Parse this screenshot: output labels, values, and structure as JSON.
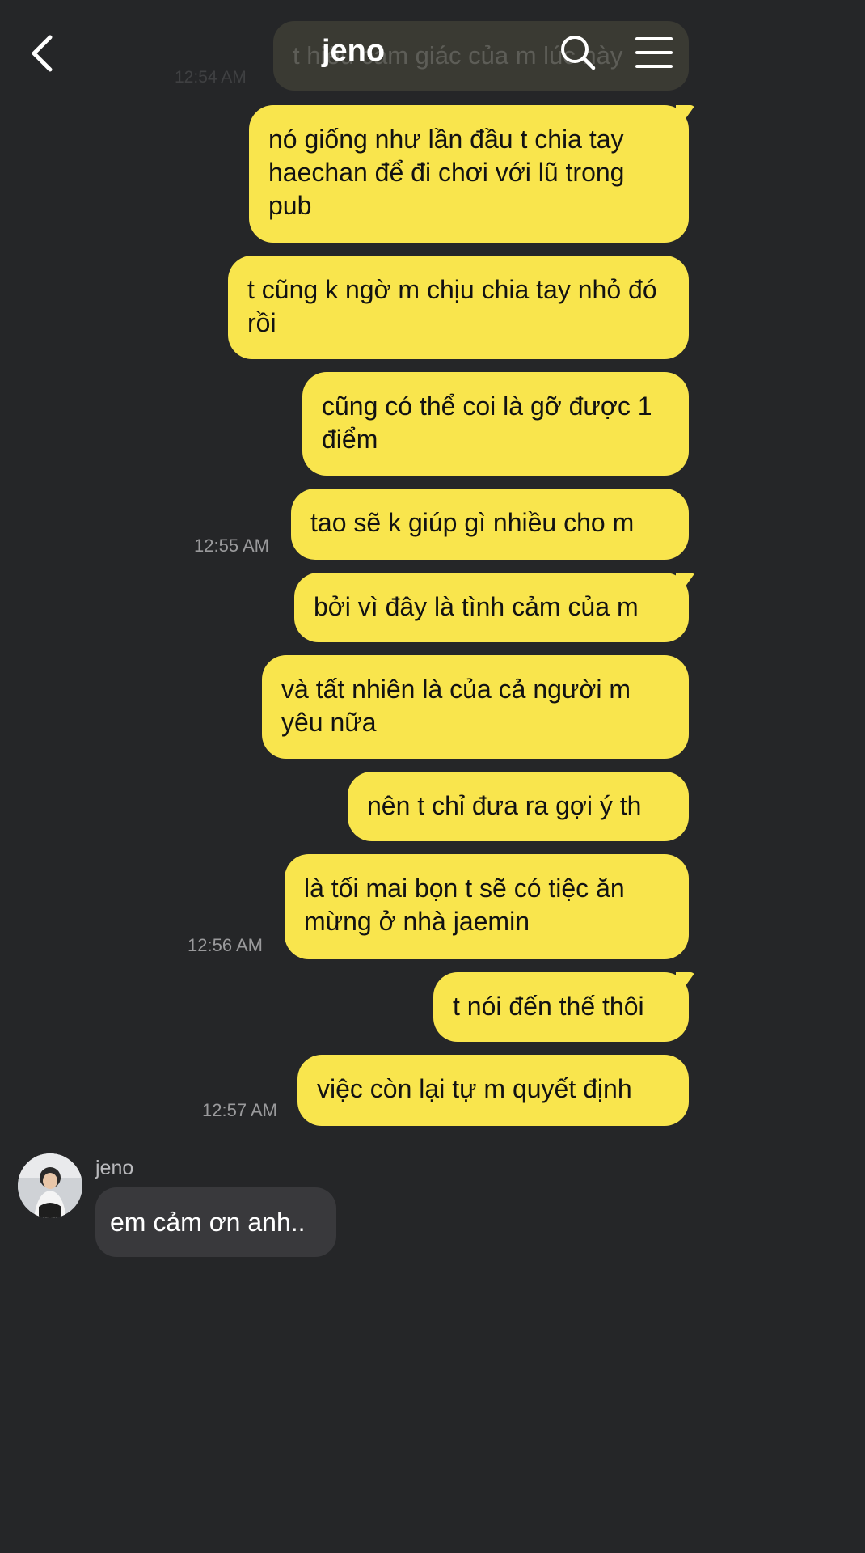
{
  "header": {
    "title": "jeno"
  },
  "ghost": {
    "text": "t hiểu cảm giác của m lúc này",
    "time": "12:54 AM"
  },
  "messages": [
    {
      "text": "nó giống như lần đầu t chia tay haechan để đi chơi với lũ trong pub"
    },
    {
      "text": "t cũng k ngờ m chịu chia tay nhỏ đó rồi"
    },
    {
      "text": "cũng có thể coi là gỡ được 1 điểm"
    },
    {
      "text": "tao sẽ k giúp gì nhiều cho m",
      "time": "12:55 AM"
    },
    {
      "text": "bởi vì đây là tình cảm của m"
    },
    {
      "text": "và tất nhiên là của cả người m yêu nữa"
    },
    {
      "text": "nên t chỉ đưa ra gợi ý th"
    },
    {
      "text": "là tối mai bọn t sẽ có tiệc ăn mừng ở nhà jaemin",
      "time": "12:56 AM"
    },
    {
      "text": "t nói đến thế thôi"
    },
    {
      "text": "việc còn lại tự m quyết định",
      "time": "12:57 AM"
    }
  ],
  "incoming": {
    "sender": "jeno",
    "text": "em cảm ơn anh.."
  },
  "colors": {
    "background": "#252628",
    "outgoing": "#f9e54d",
    "incoming": "#39393c"
  },
  "icons": [
    "back-arrow-icon",
    "search-icon",
    "menu-icon"
  ]
}
